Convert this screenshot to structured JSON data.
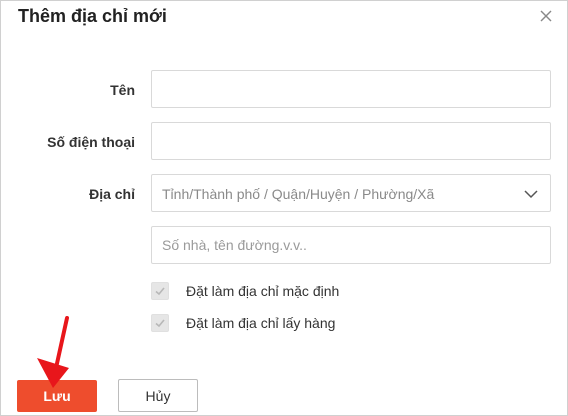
{
  "dialog": {
    "title": "Thêm địa chỉ mới",
    "close_icon": "close-icon"
  },
  "form": {
    "name_label": "Tên",
    "name_value": "",
    "phone_label": "Số điện thoại",
    "phone_value": "",
    "address_label": "Địa chỉ",
    "region_placeholder": "Tỉnh/Thành phố / Quận/Huyện / Phường/Xã",
    "region_icon": "chevron-down-icon",
    "street_placeholder": "Số nhà, tên đường.v.v..",
    "street_value": ""
  },
  "options": [
    {
      "label": "Đặt làm địa chỉ mặc định",
      "checked": true
    },
    {
      "label": "Đặt làm địa chỉ lấy hàng",
      "checked": true
    }
  ],
  "buttons": {
    "save_label": "Lưu",
    "cancel_label": "Hủy"
  },
  "colors": {
    "accent": "#ee4d2d",
    "annotation_arrow": "#e8161b"
  }
}
